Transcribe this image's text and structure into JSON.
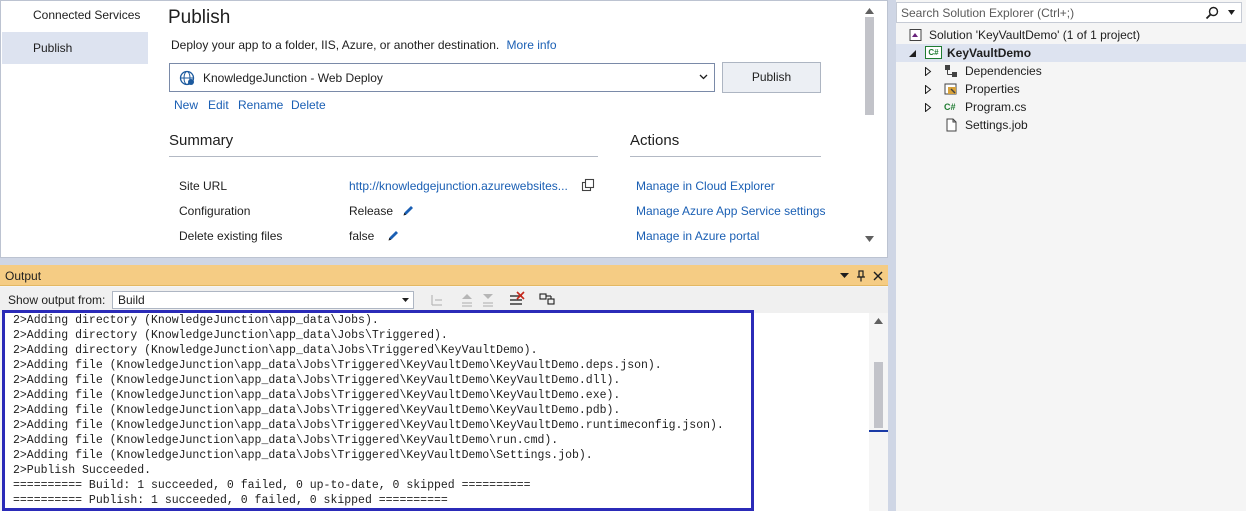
{
  "publish_page": {
    "nav": [
      {
        "label": "Connected Services",
        "active": false
      },
      {
        "label": "Publish",
        "active": true
      }
    ],
    "title": "Publish",
    "description": "Deploy your app to a folder, IIS, Azure, or another destination.",
    "more_info_link": "More info",
    "profile": {
      "selected": "KnowledgeJunction - Web Deploy",
      "publish_button": "Publish",
      "actions": [
        "New",
        "Edit",
        "Rename",
        "Delete"
      ]
    },
    "summary": {
      "heading": "Summary",
      "rows": [
        {
          "label": "Site URL",
          "value": "http://knowledgejunction.azurewebsites..."
        },
        {
          "label": "Configuration",
          "value": "Release"
        },
        {
          "label": "Delete existing files",
          "value": "false"
        }
      ]
    },
    "actions": {
      "heading": "Actions",
      "links": [
        "Manage in Cloud Explorer",
        "Manage Azure App Service settings",
        "Manage in Azure portal"
      ]
    }
  },
  "output": {
    "title": "Output",
    "show_from_label": "Show output from:",
    "source": "Build",
    "lines": [
      "2>Adding directory (KnowledgeJunction\\app_data\\Jobs).",
      "2>Adding directory (KnowledgeJunction\\app_data\\Jobs\\Triggered).",
      "2>Adding directory (KnowledgeJunction\\app_data\\Jobs\\Triggered\\KeyVaultDemo).",
      "2>Adding file (KnowledgeJunction\\app_data\\Jobs\\Triggered\\KeyVaultDemo\\KeyVaultDemo.deps.json).",
      "2>Adding file (KnowledgeJunction\\app_data\\Jobs\\Triggered\\KeyVaultDemo\\KeyVaultDemo.dll).",
      "2>Adding file (KnowledgeJunction\\app_data\\Jobs\\Triggered\\KeyVaultDemo\\KeyVaultDemo.exe).",
      "2>Adding file (KnowledgeJunction\\app_data\\Jobs\\Triggered\\KeyVaultDemo\\KeyVaultDemo.pdb).",
      "2>Adding file (KnowledgeJunction\\app_data\\Jobs\\Triggered\\KeyVaultDemo\\KeyVaultDemo.runtimeconfig.json).",
      "2>Adding file (KnowledgeJunction\\app_data\\Jobs\\Triggered\\KeyVaultDemo\\run.cmd).",
      "2>Adding file (KnowledgeJunction\\app_data\\Jobs\\Triggered\\KeyVaultDemo\\Settings.job).",
      "2>Publish Succeeded.",
      "========== Build: 1 succeeded, 0 failed, 0 up-to-date, 0 skipped ==========",
      "========== Publish: 1 succeeded, 0 failed, 0 skipped =========="
    ]
  },
  "solution_explorer": {
    "search_placeholder": "Search Solution Explorer (Ctrl+;)",
    "solution": "Solution 'KeyVaultDemo' (1 of 1 project)",
    "project": "KeyVaultDemo",
    "project_icon_text": "C#",
    "items": [
      {
        "label": "Dependencies",
        "icon": "dependencies-icon"
      },
      {
        "label": "Properties",
        "icon": "properties-icon"
      },
      {
        "label": "Program.cs",
        "icon": "csharp-file-icon",
        "icon_text": "C#"
      },
      {
        "label": "Settings.job",
        "icon": "file-icon"
      }
    ]
  },
  "colors": {
    "link": "#1a5fb4",
    "output_header": "#f5cc84",
    "highlight_border": "#2b2bb8",
    "nav_active": "#dde3f0"
  }
}
